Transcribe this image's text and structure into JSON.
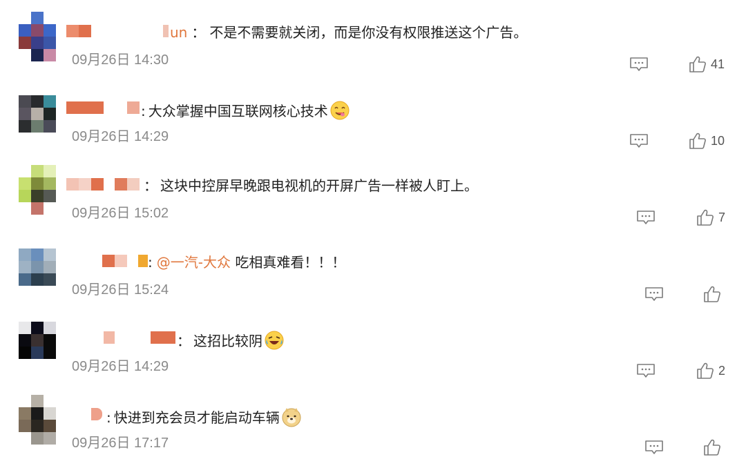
{
  "comments": [
    {
      "name_suffix": "un",
      "separator": "：",
      "mention": "",
      "text": "不是不需要就关闭，而是你没有权限推送这个广告。",
      "emoji": "",
      "time": "09月26日 14:30",
      "likes": "41"
    },
    {
      "name_suffix": "",
      "separator": ":",
      "mention": "",
      "text": "大众掌握中国互联网核心技术",
      "emoji": "yummy-face-emoji",
      "time": "09月26日 14:29",
      "likes": "10"
    },
    {
      "name_suffix": "",
      "separator": "：",
      "mention": "",
      "text": "这块中控屏早晚跟电视机的开屏广告一样被人盯上。",
      "emoji": "",
      "time": "09月26日 15:02",
      "likes": "7"
    },
    {
      "name_suffix": "",
      "separator": ":",
      "mention": "@一汽-大众",
      "text": " 吃相真难看！！！",
      "emoji": "",
      "time": "09月26日 15:24",
      "likes": ""
    },
    {
      "name_suffix": "",
      "separator": "：",
      "mention": "",
      "text": "这招比较阴",
      "emoji": "laughing-tears-emoji",
      "time": "09月26日 14:29",
      "likes": "2"
    },
    {
      "name_suffix": "",
      "separator": ":",
      "mention": "",
      "text": "快进到充会员才能启动车辆",
      "emoji": "doge-emoji",
      "time": "09月26日 17:17",
      "likes": ""
    }
  ],
  "icons": {
    "reply": "comment-icon",
    "like": "thumbs-up-icon"
  },
  "colors": {
    "mention": "#e0773d",
    "time": "#8a8a8a",
    "icon": "#7a7a7a"
  }
}
